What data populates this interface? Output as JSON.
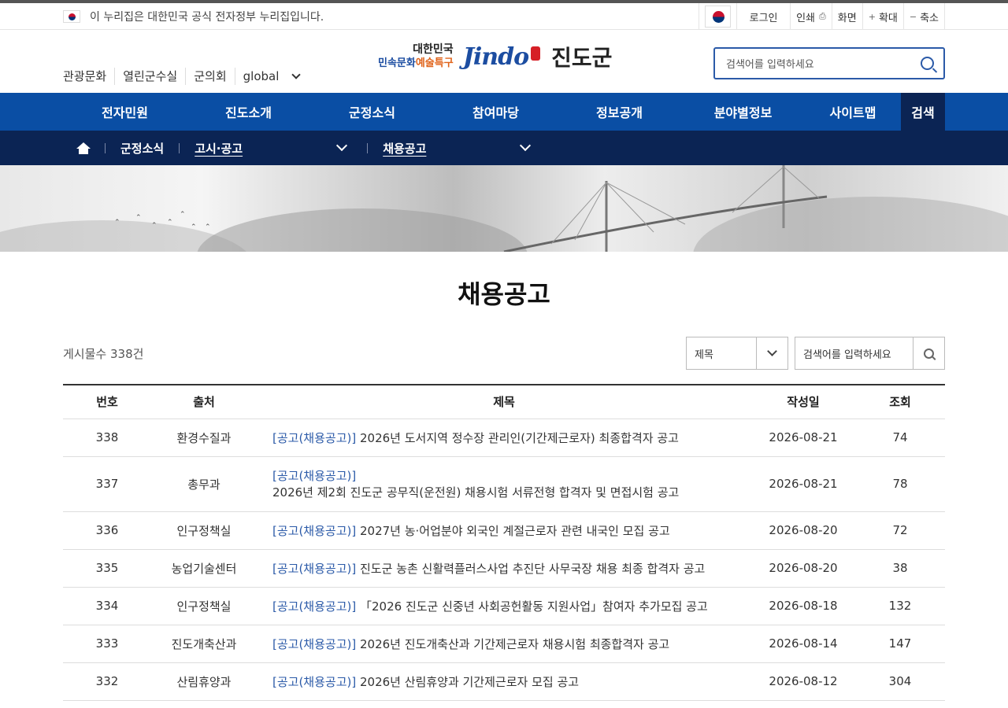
{
  "gov_banner": {
    "text": "이 누리집은 대한민국 공식 전자정부 누리집입니다.",
    "login": "로그인",
    "print": "인쇄",
    "screen": "화면",
    "zoom_in": "확대",
    "zoom_out": "축소"
  },
  "header": {
    "util_links": [
      "관광문화",
      "열린군수실",
      "군의회",
      "global"
    ],
    "logo_line1": "대한민국",
    "logo_line2a": "민속문화",
    "logo_line2b": "예술특구",
    "logo_brand": "Jindo",
    "logo_name": "진도군",
    "search_placeholder": "검색어를 입력하세요"
  },
  "gnb": [
    "전자민원",
    "진도소개",
    "군정소식",
    "참여마당",
    "정보공개",
    "분야별정보",
    "사이트맵",
    "검색"
  ],
  "breadcrumb": {
    "level1": "군정소식",
    "level2": "고시·공고",
    "level3": "채용공고"
  },
  "page_title": "채용공고",
  "list": {
    "count_label": "게시물수",
    "count_value": "338건",
    "filter_selected": "제목",
    "search_placeholder": "검색어를 입력하세요",
    "columns": [
      "번호",
      "출처",
      "제목",
      "작성일",
      "조회"
    ],
    "rows": [
      {
        "no": "338",
        "dept": "환경수질과",
        "cat": "[공고(채용공고)]",
        "title": "2026년 도서지역 정수장 관리인(기간제근로자) 최종합격자 공고",
        "date": "2026-08-21",
        "views": "74"
      },
      {
        "no": "337",
        "dept": "총무과",
        "cat": "[공고(채용공고)]",
        "title": "2026년 제2회 진도군 공무직(운전원) 채용시험 서류전형 합격자 및 면접시험 공고",
        "date": "2026-08-21",
        "views": "78"
      },
      {
        "no": "336",
        "dept": "인구정책실",
        "cat": "[공고(채용공고)]",
        "title": "2027년 농·어업분야 외국인 계절근로자 관련 내국인 모집 공고",
        "date": "2026-08-20",
        "views": "72"
      },
      {
        "no": "335",
        "dept": "농업기술센터",
        "cat": "[공고(채용공고)]",
        "title": "진도군 농촌 신활력플러스사업 추진단 사무국장 채용 최종 합격자 공고",
        "date": "2026-08-20",
        "views": "38"
      },
      {
        "no": "334",
        "dept": "인구정책실",
        "cat": "[공고(채용공고)]",
        "title": "「2026 진도군 신중년 사회공헌활동 지원사업」참여자 추가모집 공고",
        "date": "2026-08-18",
        "views": "132"
      },
      {
        "no": "333",
        "dept": "진도개축산과",
        "cat": "[공고(채용공고)]",
        "title": "2026년 진도개축산과 기간제근로자 채용시험 최종합격자 공고",
        "date": "2026-08-14",
        "views": "147"
      },
      {
        "no": "332",
        "dept": "산림휴양과",
        "cat": "[공고(채용공고)]",
        "title": "2026년 산림휴양과 기간제근로자 모집 공고",
        "date": "2026-08-12",
        "views": "304"
      }
    ]
  }
}
